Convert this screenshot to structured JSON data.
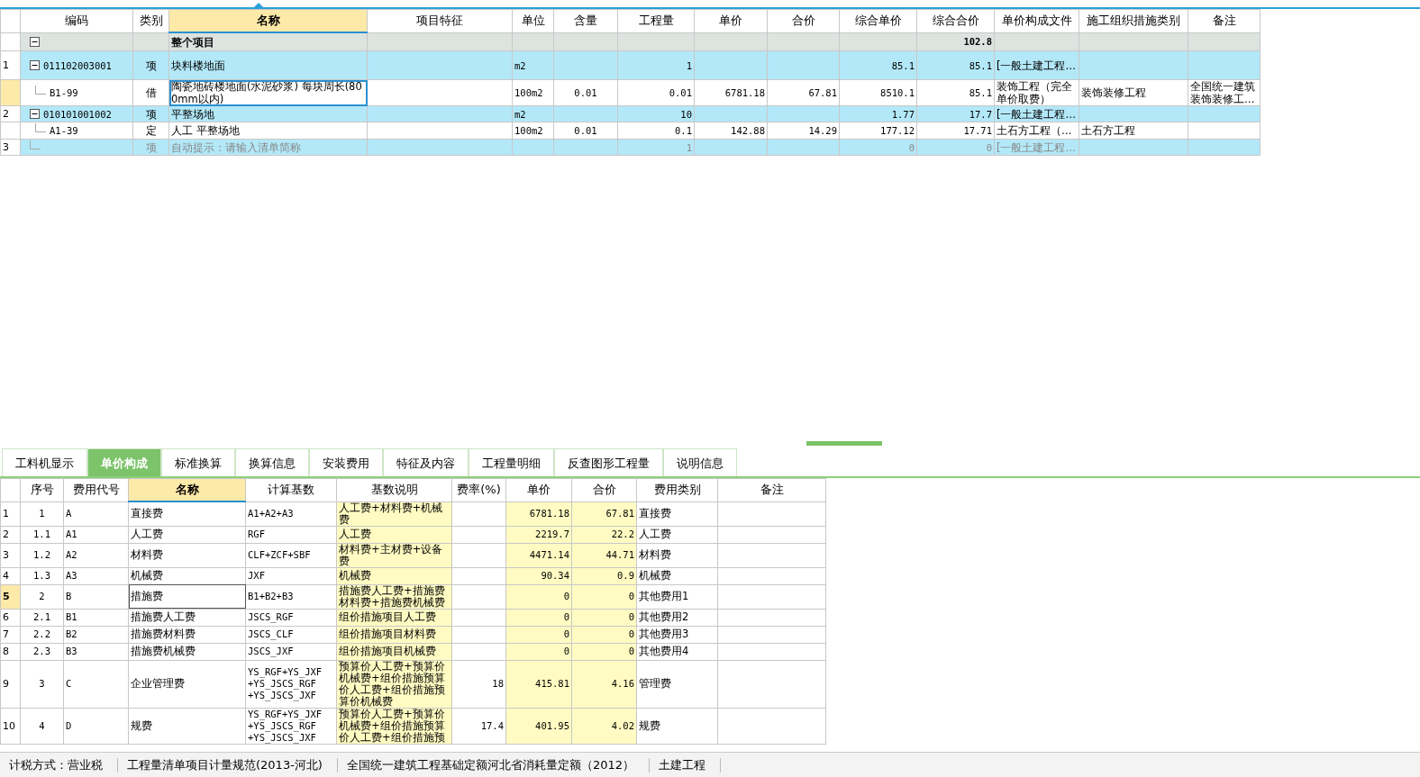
{
  "top_table": {
    "columns": [
      {
        "label": "编码",
        "selected": false
      },
      {
        "label": "类别",
        "selected": false
      },
      {
        "label": "名称",
        "selected": true
      },
      {
        "label": "项目特征",
        "selected": false
      },
      {
        "label": "单位",
        "selected": false
      },
      {
        "label": "含量",
        "selected": false
      },
      {
        "label": "工程量",
        "selected": false
      },
      {
        "label": "单价",
        "selected": false
      },
      {
        "label": "合价",
        "selected": false
      },
      {
        "label": "综合单价",
        "selected": false
      },
      {
        "label": "综合合价",
        "selected": false
      },
      {
        "label": "单价构成文件",
        "selected": false
      },
      {
        "label": "施工组织措施类别",
        "selected": false
      },
      {
        "label": "备注",
        "selected": false
      }
    ],
    "rows": [
      {
        "kind": "root",
        "selected": false,
        "expanded": true,
        "name": "整个项目",
        "composite_total": "102.8"
      },
      {
        "kind": "list",
        "selected": false,
        "expanded": true,
        "row_no": "1",
        "code": "011102003001",
        "type": "项",
        "name": "块料楼地面",
        "unit": "m2",
        "quantity": "1",
        "composite_price": "85.1",
        "composite_total": "85.1",
        "price_file": "[一般土建工程…"
      },
      {
        "kind": "quota",
        "selected": true,
        "code": "B1-99",
        "type": "借",
        "name": "陶瓷地砖楼地面(水泥砂浆) 每块周长(800mm以内)",
        "unit": "100m2",
        "content": "0.01",
        "quantity": "0.01",
        "price": "6781.18",
        "total": "67.81",
        "composite_price": "8510.1",
        "composite_total": "85.1",
        "price_file": "装饰工程（完全单价取费）",
        "measure_category": "装饰装修工程",
        "note": "全国统一建筑装饰装修工…"
      },
      {
        "kind": "list",
        "selected": false,
        "expanded": true,
        "row_no": "2",
        "code": "010101001002",
        "type": "项",
        "name": "平整场地",
        "unit": "m2",
        "quantity": "10",
        "composite_price": "1.77",
        "composite_total": "17.7",
        "price_file": "[一般土建工程…"
      },
      {
        "kind": "quota",
        "selected": false,
        "code": "A1-39",
        "type": "定",
        "name": "人工  平整场地",
        "unit": "100m2",
        "content": "0.01",
        "quantity": "0.1",
        "price": "142.88",
        "total": "14.29",
        "composite_price": "177.12",
        "composite_total": "17.71",
        "price_file": "土石方工程（…",
        "measure_category": "土石方工程"
      },
      {
        "kind": "hint",
        "selected": false,
        "row_no": "3",
        "type": "项",
        "name": "自动提示：请输入清单简称",
        "quantity": "1",
        "composite_price": "0",
        "composite_total": "0",
        "price_file": "[一般土建工程…"
      }
    ]
  },
  "tabs": [
    {
      "label": "工料机显示",
      "selected": false
    },
    {
      "label": "单价构成",
      "selected": true
    },
    {
      "label": "标准换算",
      "selected": false
    },
    {
      "label": "换算信息",
      "selected": false
    },
    {
      "label": "安装费用",
      "selected": false
    },
    {
      "label": "特征及内容",
      "selected": false
    },
    {
      "label": "工程量明细",
      "selected": false
    },
    {
      "label": "反查图形工程量",
      "selected": false
    },
    {
      "label": "说明信息",
      "selected": false
    }
  ],
  "bottom_table": {
    "columns": [
      {
        "label": "序号",
        "selected": false
      },
      {
        "label": "费用代号",
        "selected": false
      },
      {
        "label": "名称",
        "selected": true
      },
      {
        "label": "计算基数",
        "selected": false
      },
      {
        "label": "基数说明",
        "selected": false
      },
      {
        "label": "费率(%)",
        "selected": false
      },
      {
        "label": "单价",
        "selected": false
      },
      {
        "label": "合价",
        "selected": false
      },
      {
        "label": "费用类别",
        "selected": false
      },
      {
        "label": "备注",
        "selected": false
      }
    ],
    "rows": [
      {
        "row_no": "1",
        "selected": false,
        "seq": "1",
        "fee_code": "A",
        "name": "直接费",
        "calc_base": "A1+A2+A3",
        "base_desc": "人工费+材料费+机械费",
        "price": "6781.18",
        "total": "67.81",
        "fee_category": "直接费"
      },
      {
        "row_no": "2",
        "selected": false,
        "seq": "1.1",
        "fee_code": "A1",
        "name": "人工费",
        "calc_base": "RGF",
        "base_desc": "人工费",
        "price": "2219.7",
        "total": "22.2",
        "fee_category": "人工费"
      },
      {
        "row_no": "3",
        "selected": false,
        "seq": "1.2",
        "fee_code": "A2",
        "name": "材料费",
        "calc_base": "CLF+ZCF+SBF",
        "base_desc": "材料费+主材费+设备费",
        "price": "4471.14",
        "total": "44.71",
        "fee_category": "材料费"
      },
      {
        "row_no": "4",
        "selected": false,
        "seq": "1.3",
        "fee_code": "A3",
        "name": "机械费",
        "calc_base": "JXF",
        "base_desc": "机械费",
        "price": "90.34",
        "total": "0.9",
        "fee_category": "机械费"
      },
      {
        "row_no": "5",
        "selected": true,
        "seq": "2",
        "fee_code": "B",
        "name": "措施费",
        "calc_base": "B1+B2+B3",
        "base_desc": "措施费人工费+措施费材料费+措施费机械费",
        "price": "0",
        "total": "0",
        "fee_category": "其他费用1"
      },
      {
        "row_no": "6",
        "selected": false,
        "seq": "2.1",
        "fee_code": "B1",
        "name": "措施费人工费",
        "calc_base": "JSCS_RGF",
        "base_desc": "组价措施项目人工费",
        "price": "0",
        "total": "0",
        "fee_category": "其他费用2"
      },
      {
        "row_no": "7",
        "selected": false,
        "seq": "2.2",
        "fee_code": "B2",
        "name": "措施费材料费",
        "calc_base": "JSCS_CLF",
        "base_desc": "组价措施项目材料费",
        "price": "0",
        "total": "0",
        "fee_category": "其他费用3"
      },
      {
        "row_no": "8",
        "selected": false,
        "seq": "2.3",
        "fee_code": "B3",
        "name": "措施费机械费",
        "calc_base": "JSCS_JXF",
        "base_desc": "组价措施项目机械费",
        "price": "0",
        "total": "0",
        "fee_category": "其他费用4"
      },
      {
        "row_no": "9",
        "selected": false,
        "seq": "3",
        "fee_code": "C",
        "name": "企业管理费",
        "calc_base": "YS_RGF+YS_JXF\n+YS_JSCS_RGF\n+YS_JSCS_JXF",
        "base_desc": "预算价人工费+预算价机械费+组价措施预算价人工费+组价措施预算价机械费",
        "rate": "18",
        "price": "415.81",
        "total": "4.16",
        "fee_category": "管理费"
      },
      {
        "row_no": "10",
        "selected": false,
        "seq": "4",
        "fee_code": "D",
        "name": "规费",
        "calc_base": "YS_RGF+YS_JXF\n+YS_JSCS_RGF\n+YS_JSCS_JXF",
        "base_desc": "预算价人工费+预算价机械费+组价措施预算价人工费+组价措施预",
        "rate": "17.4",
        "price": "401.95",
        "total": "4.02",
        "fee_category": "规费"
      }
    ]
  },
  "status_bar": [
    "计税方式：营业税",
    "工程量清单项目计量规范(2013-河北)",
    "全国统一建筑工程基础定额河北省消耗量定额（2012）",
    "土建工程"
  ]
}
